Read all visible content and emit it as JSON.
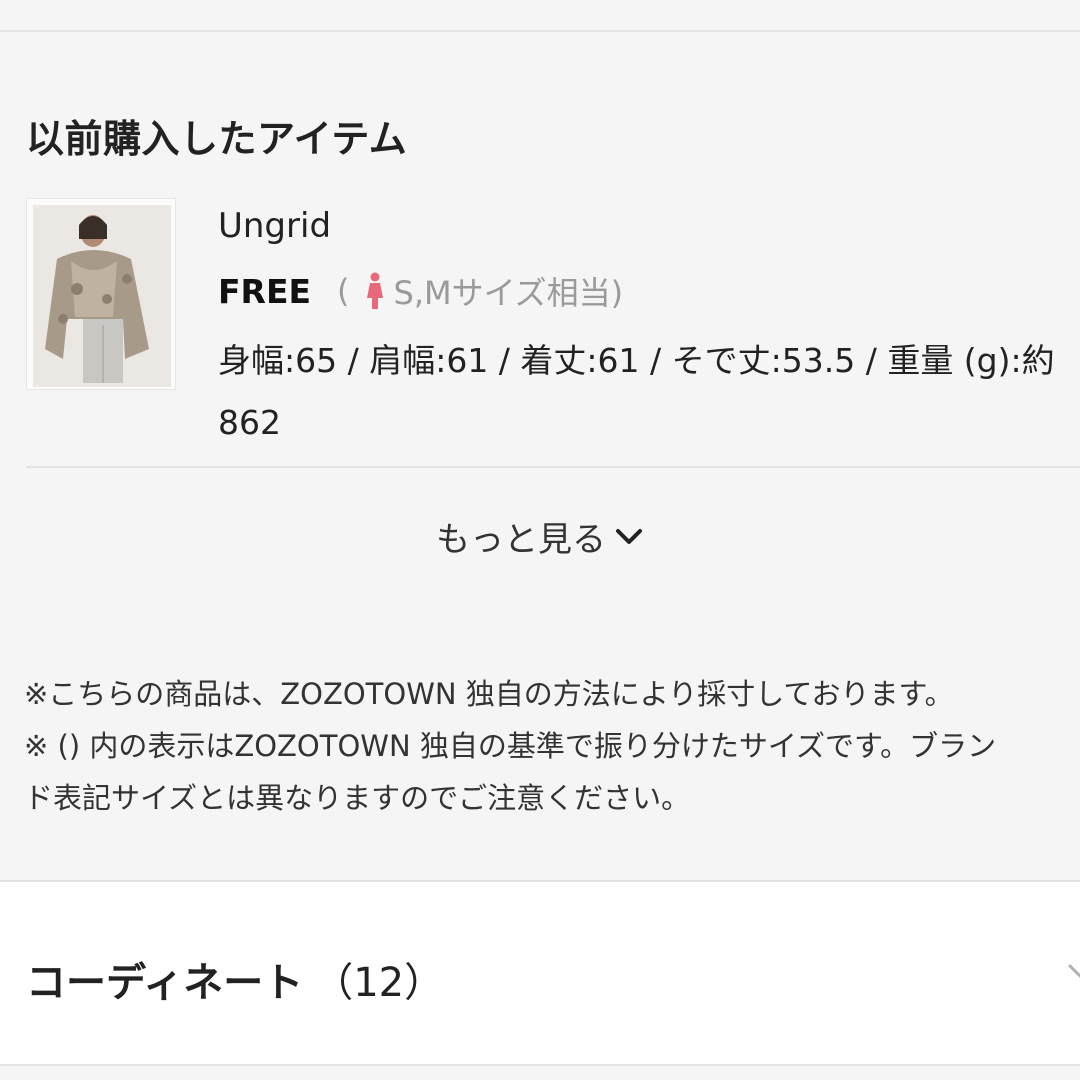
{
  "section": {
    "title": "以前購入したアイテム"
  },
  "item": {
    "brand": "Ungrid",
    "size": "FREE",
    "size_hint_prefix": "(",
    "size_hint_text": "S,Mサイズ相当)",
    "measurements_line1": "身幅:65 / 肩幅:61 / 着丈:61 / そで丈:53.5 / 重量 (g):約",
    "measurements_line2": "862",
    "thumbnail_icon": "product-photo"
  },
  "more_button": {
    "label": "もっと見る",
    "icon": "chevron-down-icon"
  },
  "notes": {
    "line1": "※こちらの商品は、ZOZOTOWN 独自の方法により採寸しております。",
    "line2": "※ () 内の表示はZOZOTOWN 独自の基準で振り分けたサイズです。ブラン",
    "line3": "ド表記サイズとは異なりますのでご注意ください。"
  },
  "coordinate": {
    "title": "コーディネート",
    "count": "（12）",
    "icon": "chevron-right-icon"
  },
  "colors": {
    "background": "#f5f5f5",
    "accent_person_icon": "#e8697a",
    "hint_text": "#9a9a9a"
  }
}
